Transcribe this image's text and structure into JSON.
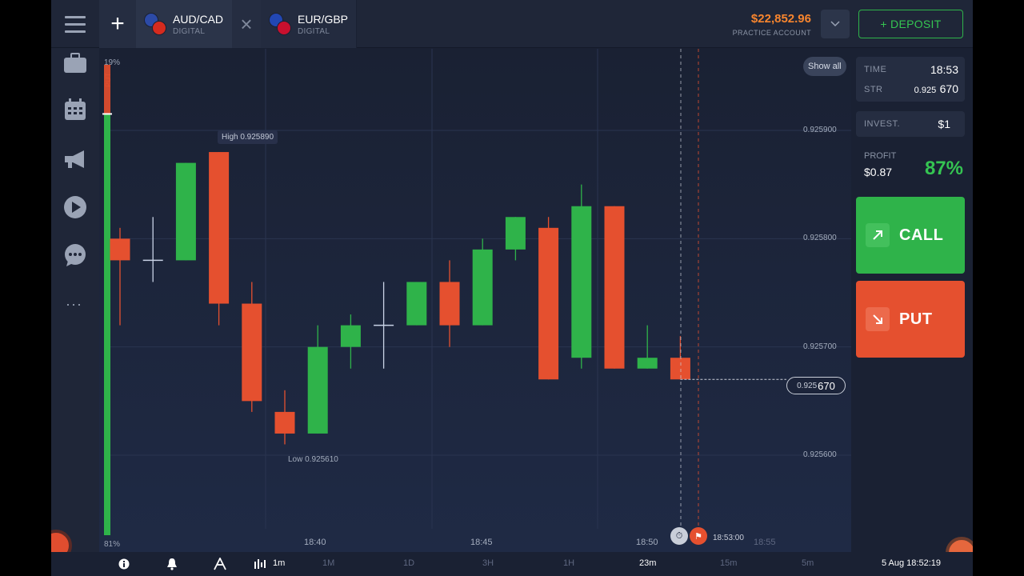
{
  "topbar": {
    "menu_icon": "hamburger-icon",
    "add_icon": "plus-icon",
    "tabs": [
      {
        "name": "AUD/CAD",
        "kind": "DIGITAL",
        "flag_a": "#2c4aa6",
        "flag_b": "#d52b1e",
        "active": true
      },
      {
        "name": "EUR/GBP",
        "kind": "DIGITAL",
        "flag_a": "#2247b3",
        "flag_b": "#c8102e",
        "active": false
      }
    ],
    "close_icon": "close-icon",
    "balance": "$22,852.96",
    "account": "PRACTICE ACCOUNT",
    "deposit_label": "+ DEPOSIT"
  },
  "sidebar": {
    "icons": [
      "briefcase-icon",
      "calendar-icon",
      "megaphone-icon",
      "play-icon",
      "chat-icon"
    ],
    "more": "···"
  },
  "chart_data": {
    "type": "candlestick",
    "put_pct": "19%",
    "call_pct": "81%",
    "put_label": "PUT",
    "call_label": "CALL",
    "show_all": "Show all",
    "price_ticks": [
      {
        "value": 0.9259,
        "label": "0.925900"
      },
      {
        "value": 0.9258,
        "label": "0.925800"
      },
      {
        "value": 0.9257,
        "label": "0.925700"
      },
      {
        "value": 0.9256,
        "label": "0.925600"
      }
    ],
    "time_ticks": [
      "18:40",
      "18:45",
      "18:50"
    ],
    "high_label": "High 0.925890",
    "low_label": "Low 0.925610",
    "current_price_small": "0.925",
    "current_price_big": "670",
    "current_price": 0.92567,
    "expiry_time": "18:53:00",
    "next_expiry": "18:55",
    "colors": {
      "up": "#2fb34a",
      "down": "#e5502f",
      "doji": "#c9d3e6"
    },
    "candles": [
      {
        "o": 0.9258,
        "h": 0.92581,
        "l": 0.92572,
        "c": 0.92578
      },
      {
        "o": 0.92578,
        "h": 0.92582,
        "l": 0.92576,
        "c": 0.92578
      },
      {
        "o": 0.92578,
        "h": 0.92587,
        "l": 0.92578,
        "c": 0.92587
      },
      {
        "o": 0.92588,
        "h": 0.92588,
        "l": 0.92572,
        "c": 0.92574
      },
      {
        "o": 0.92574,
        "h": 0.92576,
        "l": 0.92564,
        "c": 0.92565
      },
      {
        "o": 0.92564,
        "h": 0.92566,
        "l": 0.92561,
        "c": 0.92562
      },
      {
        "o": 0.92562,
        "h": 0.92572,
        "l": 0.92562,
        "c": 0.9257
      },
      {
        "o": 0.9257,
        "h": 0.92573,
        "l": 0.92568,
        "c": 0.92572
      },
      {
        "o": 0.92572,
        "h": 0.92576,
        "l": 0.92568,
        "c": 0.92572
      },
      {
        "o": 0.92572,
        "h": 0.92576,
        "l": 0.92572,
        "c": 0.92576
      },
      {
        "o": 0.92576,
        "h": 0.92578,
        "l": 0.9257,
        "c": 0.92572
      },
      {
        "o": 0.92572,
        "h": 0.9258,
        "l": 0.92572,
        "c": 0.92579
      },
      {
        "o": 0.92579,
        "h": 0.92582,
        "l": 0.92578,
        "c": 0.92582
      },
      {
        "o": 0.92581,
        "h": 0.92582,
        "l": 0.92567,
        "c": 0.92567
      },
      {
        "o": 0.92569,
        "h": 0.92585,
        "l": 0.92568,
        "c": 0.92583
      },
      {
        "o": 0.92583,
        "h": 0.92583,
        "l": 0.92568,
        "c": 0.92568
      },
      {
        "o": 0.92568,
        "h": 0.92572,
        "l": 0.92568,
        "c": 0.92569
      },
      {
        "o": 0.92569,
        "h": 0.92571,
        "l": 0.92567,
        "c": 0.92567
      }
    ]
  },
  "panel": {
    "time_label": "TIME",
    "time_value": "18:53",
    "str_label": "STR",
    "str_small": "0.925",
    "str_big": "670",
    "invest_label": "INVEST.",
    "invest_value": "$1",
    "profit_label": "PROFIT",
    "profit_amount": "$0.87",
    "profit_pct": "87%",
    "call_label": "CALL",
    "put_label": "PUT"
  },
  "bottombar": {
    "info_icon": "info-icon",
    "bell_icon": "bell-icon",
    "indicator_icon": "indicators-icon",
    "candles_icon": "candles-icon",
    "timeframes": [
      "1m",
      "1M",
      "1D",
      "3H",
      "1H",
      "23m",
      "15m",
      "5m"
    ],
    "active_timeframes": [
      "1m",
      "23m"
    ],
    "datetime": "5 Aug 18:52:19"
  }
}
